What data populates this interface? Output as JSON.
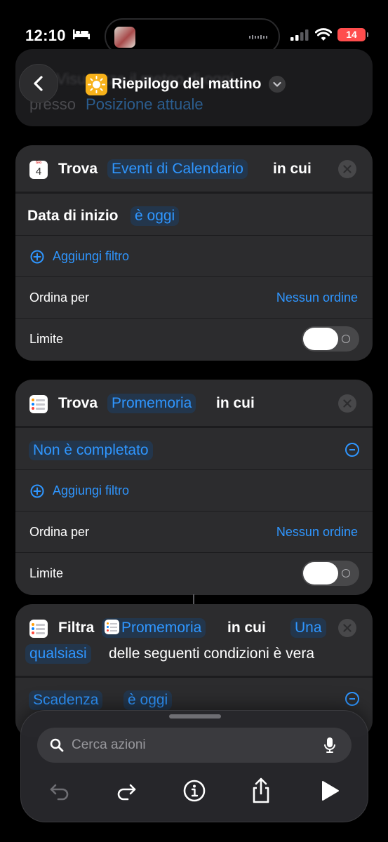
{
  "status_bar": {
    "time": "12:10",
    "battery": "14"
  },
  "nav": {
    "title": "Riepilogo del mattino"
  },
  "background_card": {
    "line1": "Visualizza il meteo di oggi",
    "line2_prefix": "presso",
    "line2_value": "Posizione attuale"
  },
  "card_calendar": {
    "verb": "Trova",
    "entity": "Eventi di Calendario",
    "connector": "in cui",
    "filter_label": "Data di inizio",
    "filter_value": "è oggi",
    "add_filter": "Aggiungi filtro",
    "sort_label": "Ordina per",
    "sort_value": "Nessun ordine",
    "limit_label": "Limite",
    "limit_on": false
  },
  "card_reminders": {
    "verb": "Trova",
    "entity": "Promemoria",
    "connector": "in cui",
    "filter_value": "Non è completato",
    "add_filter": "Aggiungi filtro",
    "sort_label": "Ordina per",
    "sort_value": "Nessun ordine",
    "limit_label": "Limite",
    "limit_on": false
  },
  "card_filter": {
    "verb": "Filtra",
    "entity": "Promemoria",
    "connector": "in cui",
    "quantifier_a": "Una",
    "quantifier_b": "qualsiasi",
    "suffix": "delle seguenti condizioni è vera",
    "condition_label": "Scadenza",
    "condition_value": "è oggi"
  },
  "bottom_panel": {
    "search_placeholder": "Cerca azioni"
  },
  "colors": {
    "accent": "#2f96ff",
    "card": "#2c2c2e",
    "background": "#000000"
  }
}
